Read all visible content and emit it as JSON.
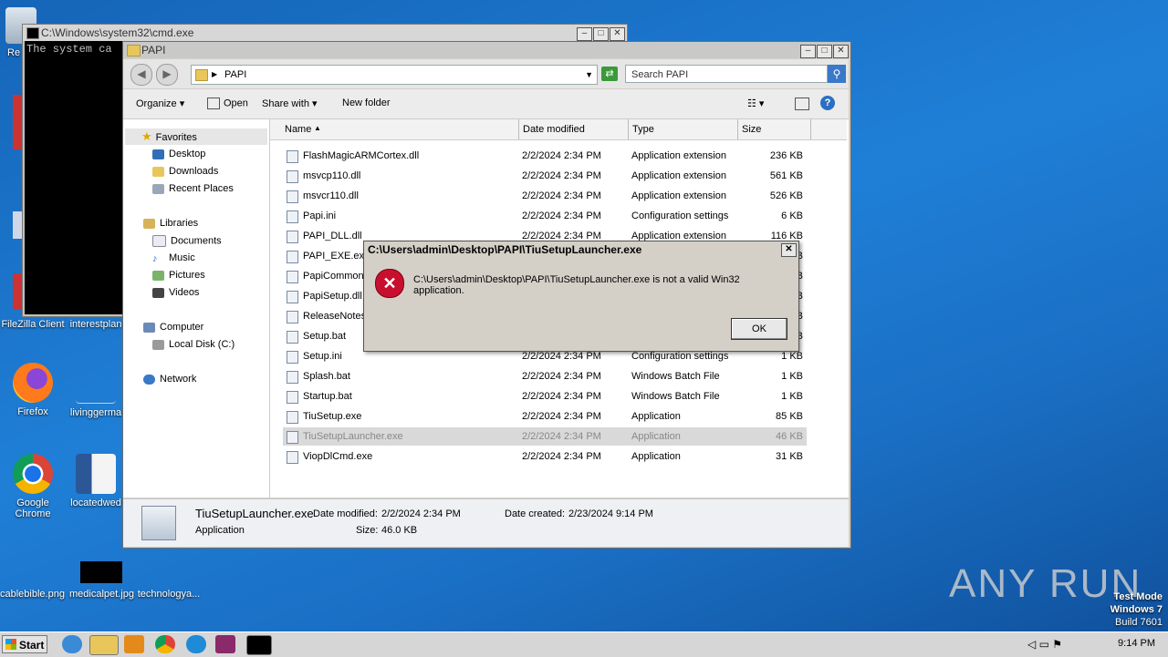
{
  "desktop": {
    "icons": [
      {
        "label": "Re",
        "x": 0
      },
      {
        "label": "FileZilla Client"
      },
      {
        "label": "interestplan"
      },
      {
        "label": "Firefox"
      },
      {
        "label": "livinggerma"
      },
      {
        "label": "Google Chrome"
      },
      {
        "label": "locatedwed"
      },
      {
        "label": "cablebible.png"
      },
      {
        "label": "medicalpet.jpg"
      },
      {
        "label": "technologya..."
      }
    ],
    "watermark": "ANY RUN",
    "test_mode": [
      "Test Mode",
      "Windows 7",
      "Build 7601"
    ]
  },
  "cmd": {
    "title": "C:\\Windows\\system32\\cmd.exe",
    "text": "The system ca"
  },
  "explorer": {
    "title": "PAPI",
    "address": "PAPI",
    "search_placeholder": "Search PAPI",
    "toolbar": {
      "organize": "Organize",
      "open": "Open",
      "share_with": "Share with",
      "new_folder": "New folder"
    },
    "nav": {
      "favorites": "Favorites",
      "desktop": "Desktop",
      "downloads": "Downloads",
      "recent": "Recent Places",
      "libraries": "Libraries",
      "documents": "Documents",
      "music": "Music",
      "pictures": "Pictures",
      "videos": "Videos",
      "computer": "Computer",
      "local_disk": "Local Disk (C:)",
      "network": "Network"
    },
    "columns": {
      "name": "Name",
      "date": "Date modified",
      "type": "Type",
      "size": "Size"
    },
    "files": [
      {
        "name": "FlashMagicARMCortex.dll",
        "date": "2/2/2024 2:34 PM",
        "type": "Application extension",
        "size": "236 KB"
      },
      {
        "name": "msvcp110.dll",
        "date": "2/2/2024 2:34 PM",
        "type": "Application extension",
        "size": "561 KB"
      },
      {
        "name": "msvcr110.dll",
        "date": "2/2/2024 2:34 PM",
        "type": "Application extension",
        "size": "526 KB"
      },
      {
        "name": "Papi.ini",
        "date": "2/2/2024 2:34 PM",
        "type": "Configuration settings",
        "size": "6 KB"
      },
      {
        "name": "PAPI_DLL.dll",
        "date": "2/2/2024 2:34 PM",
        "type": "Application extension",
        "size": "116 KB"
      },
      {
        "name": "PAPI_EXE.exe",
        "date": "",
        "type": "",
        "size": "KB"
      },
      {
        "name": "PapiCommon.",
        "date": "",
        "type": "",
        "size": "KB"
      },
      {
        "name": "PapiSetup.dll",
        "date": "",
        "type": "",
        "size": "KB"
      },
      {
        "name": "ReleaseNotes",
        "date": "",
        "type": "",
        "size": "KB"
      },
      {
        "name": "Setup.bat",
        "date": "",
        "type": "",
        "size": "KB"
      },
      {
        "name": "Setup.ini",
        "date": "2/2/2024 2:34 PM",
        "type": "Configuration settings",
        "size": "1 KB"
      },
      {
        "name": "Splash.bat",
        "date": "2/2/2024 2:34 PM",
        "type": "Windows Batch File",
        "size": "1 KB"
      },
      {
        "name": "Startup.bat",
        "date": "2/2/2024 2:34 PM",
        "type": "Windows Batch File",
        "size": "1 KB"
      },
      {
        "name": "TiuSetup.exe",
        "date": "2/2/2024 2:34 PM",
        "type": "Application",
        "size": "85 KB"
      },
      {
        "name": "TiuSetupLauncher.exe",
        "date": "2/2/2024 2:34 PM",
        "type": "Application",
        "size": "46 KB"
      },
      {
        "name": "ViopDlCmd.exe",
        "date": "2/2/2024 2:34 PM",
        "type": "Application",
        "size": "31 KB"
      }
    ],
    "details": {
      "name": "TiuSetupLauncher.exe",
      "type": "Application",
      "date_modified_label": "Date modified:",
      "date_modified": "2/2/2024 2:34 PM",
      "size_label": "Size:",
      "size": "46.0 KB",
      "date_created_label": "Date created:",
      "date_created": "2/23/2024 9:14 PM"
    }
  },
  "dialog": {
    "title": "C:\\Users\\admin\\Desktop\\PAPI\\TiuSetupLauncher.exe",
    "message": "C:\\Users\\admin\\Desktop\\PAPI\\TiuSetupLauncher.exe is not a valid Win32 application.",
    "ok": "OK"
  },
  "taskbar": {
    "start": "Start",
    "clock": "9:14 PM"
  }
}
